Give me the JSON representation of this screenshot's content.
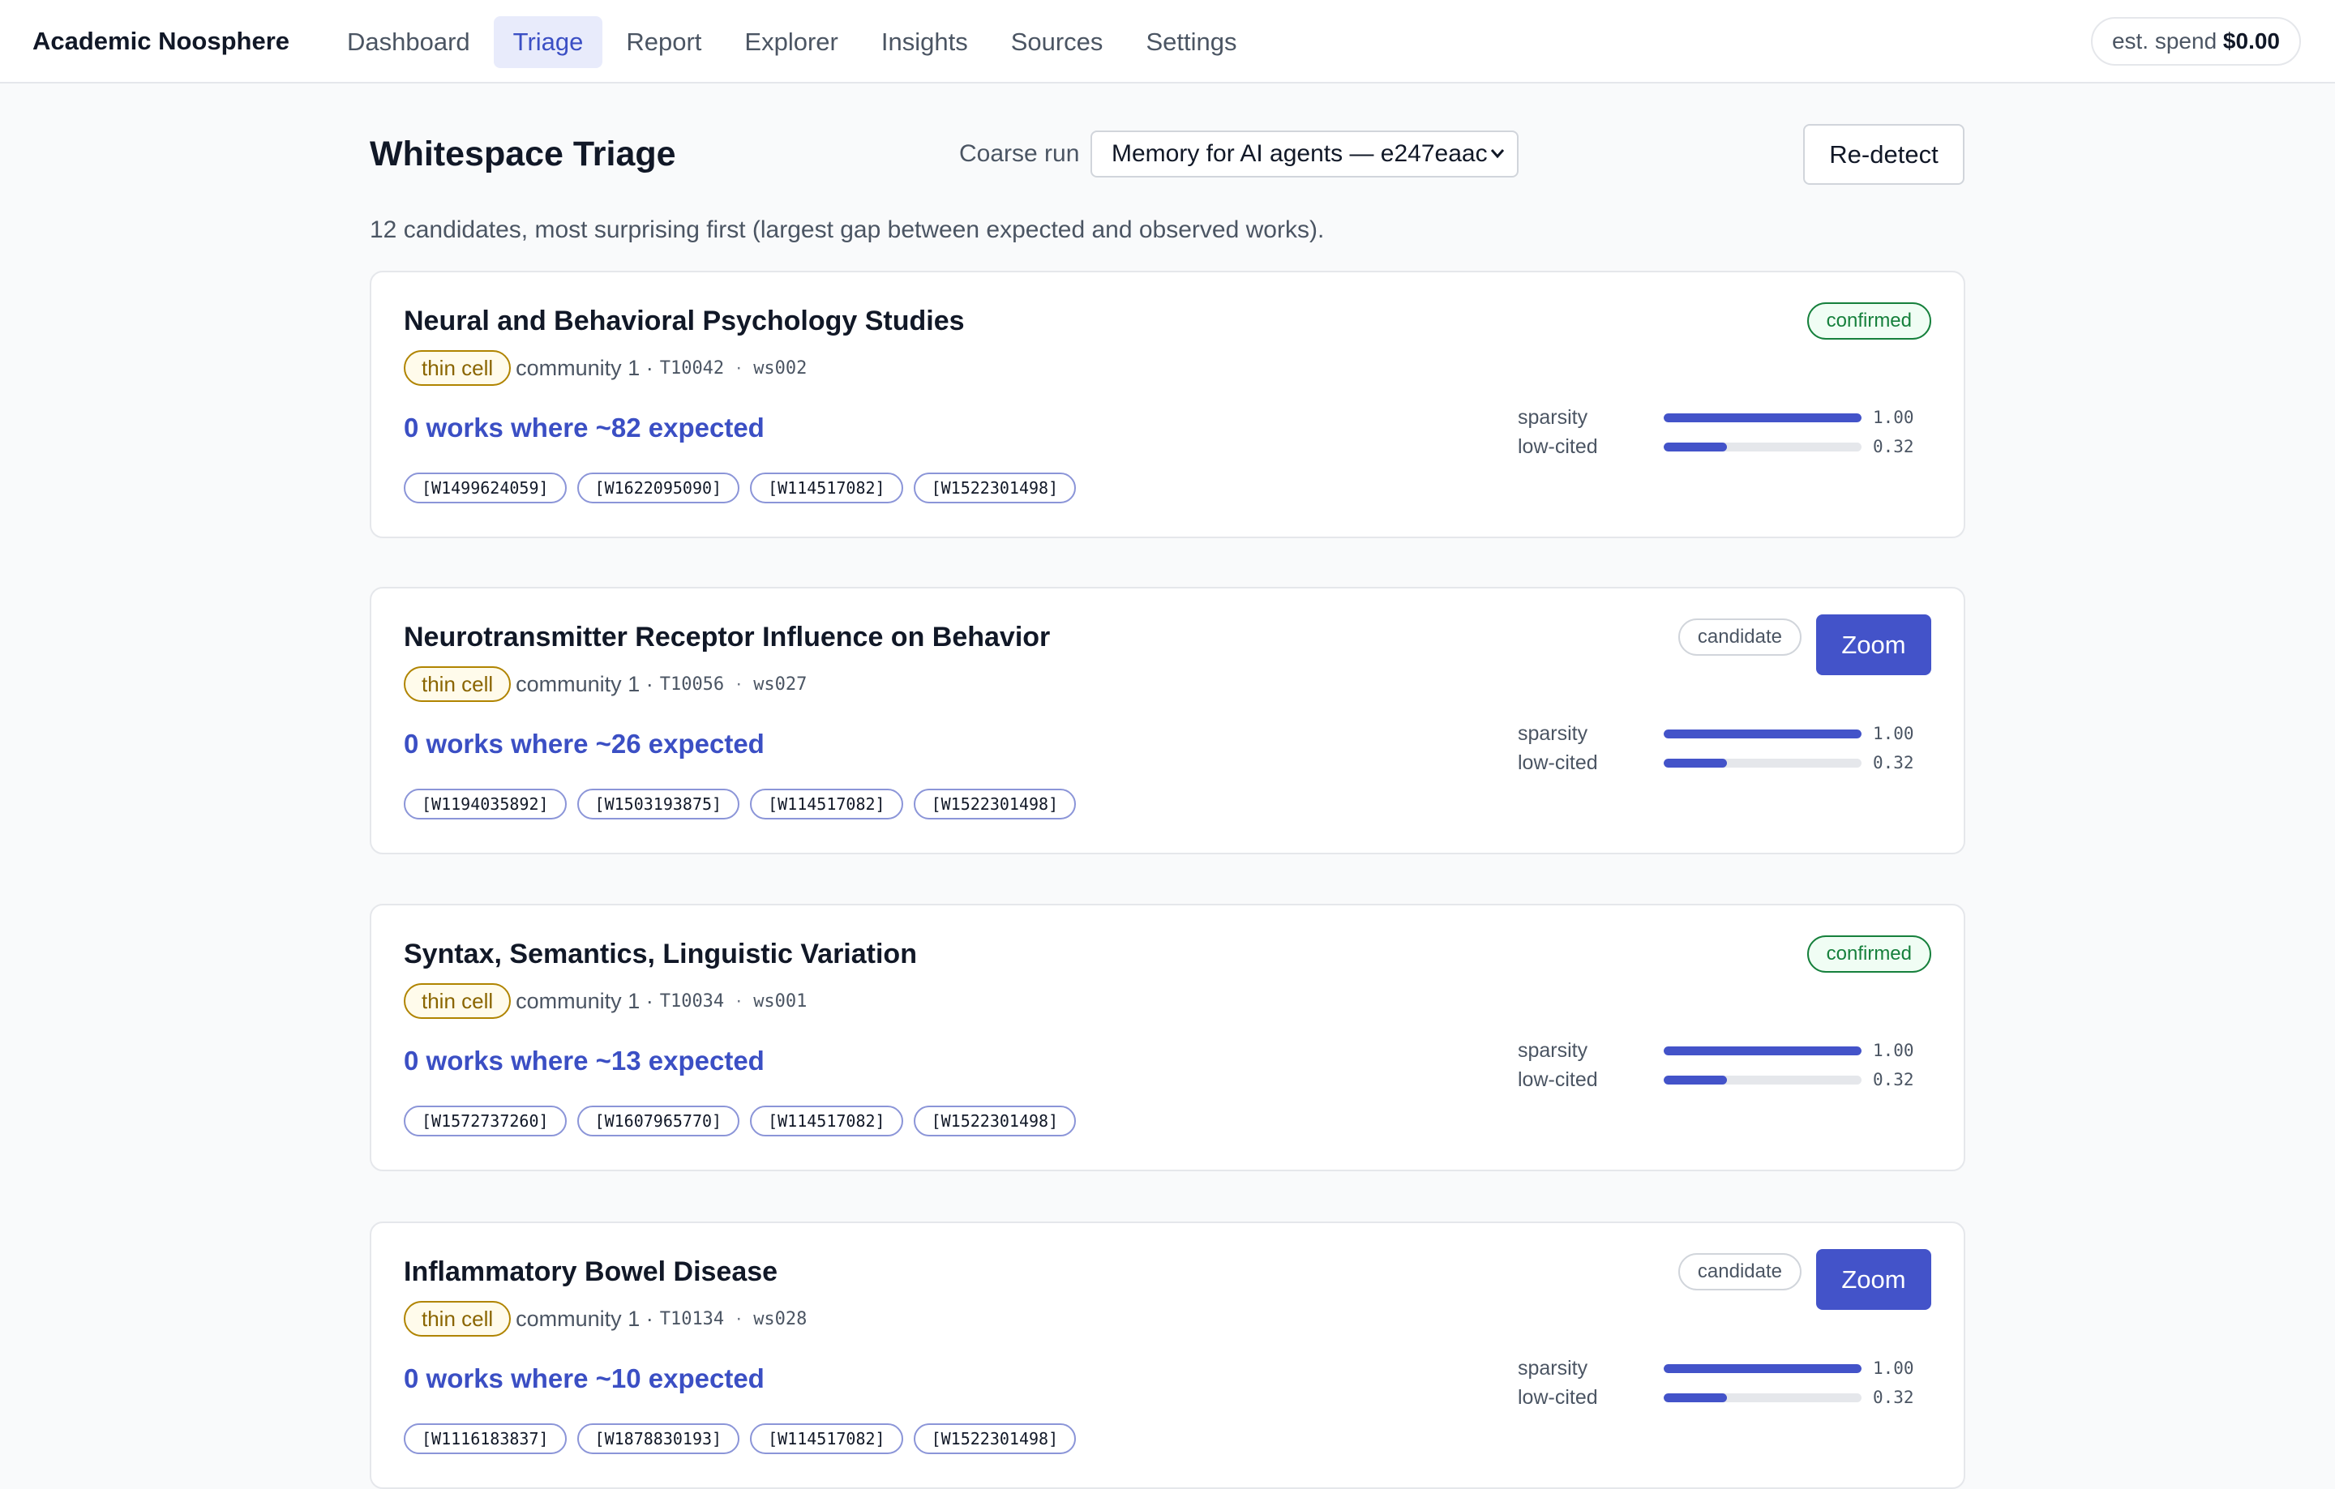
{
  "app": {
    "brand": "Academic Noosphere"
  },
  "nav": [
    {
      "label": "Dashboard",
      "active": false
    },
    {
      "label": "Triage",
      "active": true
    },
    {
      "label": "Report",
      "active": false
    },
    {
      "label": "Explorer",
      "active": false
    },
    {
      "label": "Insights",
      "active": false
    },
    {
      "label": "Sources",
      "active": false
    },
    {
      "label": "Settings",
      "active": false
    }
  ],
  "spend": {
    "label": "est. spend",
    "value": "$0.00"
  },
  "header": {
    "title": "Whitespace Triage",
    "run_label": "Coarse run",
    "run_selected": "Memory for AI agents — e247eaac",
    "redetect_label": "Re-detect",
    "summary": "12 candidates, most surprising first (largest gap between expected and observed works)."
  },
  "labels": {
    "zoom": "Zoom",
    "sparsity": "sparsity",
    "low_cited": "low-cited"
  },
  "cards": [
    {
      "title": "Neural and Behavioral Psychology Studies",
      "tag": "thin cell",
      "community": "community 1 ·",
      "topic": "T10042",
      "dot": "·",
      "ws": "ws002",
      "headline": "0 works where ~82 expected",
      "chips": [
        "[W1499624059]",
        "[W1622095090]",
        "[W114517082]",
        "[W1522301498]"
      ],
      "status": "confirmed",
      "has_zoom": false,
      "sparsity": 1.0,
      "sparsity_text": "1.00",
      "low_cited": 0.32,
      "low_cited_text": "0.32"
    },
    {
      "title": "Neurotransmitter Receptor Influence on Behavior",
      "tag": "thin cell",
      "community": "community 1 ·",
      "topic": "T10056",
      "dot": "·",
      "ws": "ws027",
      "headline": "0 works where ~26 expected",
      "chips": [
        "[W1194035892]",
        "[W1503193875]",
        "[W114517082]",
        "[W1522301498]"
      ],
      "status": "candidate",
      "has_zoom": true,
      "sparsity": 1.0,
      "sparsity_text": "1.00",
      "low_cited": 0.32,
      "low_cited_text": "0.32"
    },
    {
      "title": "Syntax, Semantics, Linguistic Variation",
      "tag": "thin cell",
      "community": "community 1 ·",
      "topic": "T10034",
      "dot": "·",
      "ws": "ws001",
      "headline": "0 works where ~13 expected",
      "chips": [
        "[W1572737260]",
        "[W1607965770]",
        "[W114517082]",
        "[W1522301498]"
      ],
      "status": "confirmed",
      "has_zoom": false,
      "sparsity": 1.0,
      "sparsity_text": "1.00",
      "low_cited": 0.32,
      "low_cited_text": "0.32"
    },
    {
      "title": "Inflammatory Bowel Disease",
      "tag": "thin cell",
      "community": "community 1 ·",
      "topic": "T10134",
      "dot": "·",
      "ws": "ws028",
      "headline": "0 works where ~10 expected",
      "chips": [
        "[W1116183837]",
        "[W1878830193]",
        "[W114517082]",
        "[W1522301498]"
      ],
      "status": "candidate",
      "has_zoom": true,
      "sparsity": 1.0,
      "sparsity_text": "1.00",
      "low_cited": 0.32,
      "low_cited_text": "0.32"
    }
  ]
}
